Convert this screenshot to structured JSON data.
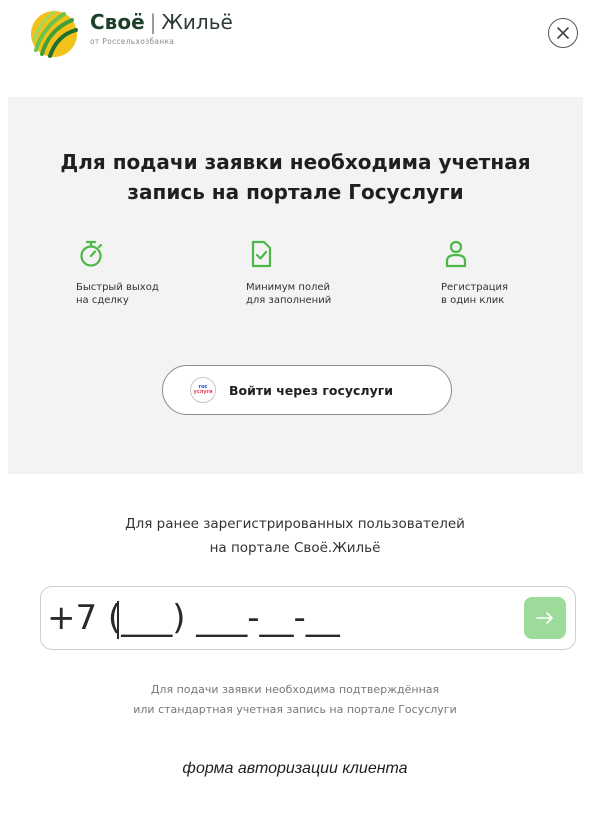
{
  "header": {
    "brand_primary": "Своё",
    "brand_separator": "|",
    "brand_secondary": "Жильё",
    "brand_subtitle": "от Россельхозбанка",
    "logo_icon": "leaf-swirl-logo",
    "close_icon": "close-icon"
  },
  "auth_panel": {
    "title_line1": "Для подачи заявки необходима учетная",
    "title_line2": "запись на портале Госуслуги",
    "features": [
      {
        "icon": "stopwatch-icon",
        "line1": "Быстрый выход",
        "line2": "на сделку"
      },
      {
        "icon": "document-check-icon",
        "line1": "Минимум полей",
        "line2": "для заполнений"
      },
      {
        "icon": "user-icon",
        "line1": "Регистрация",
        "line2": "в один клик"
      }
    ],
    "gosuslugi_button": {
      "logo_line1": "гос",
      "logo_line2": "услуги",
      "label": "Войти через госуслуги"
    }
  },
  "login": {
    "intro_line1": "Для ранее зарегистрированных пользователей",
    "intro_line2": "на портале Своё.Жильё",
    "phone_placeholder": "+7 (___) ___-__-__",
    "submit_icon": "arrow-right-icon",
    "note_line1": "Для подачи заявки необходима подтверждённая",
    "note_line2": "или стандартная учетная запись на портале Госуслуги"
  },
  "caption": "форма авторизации клиента",
  "colors": {
    "accent_green": "#4cb848",
    "button_green_light": "#9ddb9b",
    "panel_bg": "#f3f3f3",
    "brand_dark": "#1e3f2a",
    "gos_blue": "#0d4cd3",
    "gos_red": "#ee3f58"
  }
}
